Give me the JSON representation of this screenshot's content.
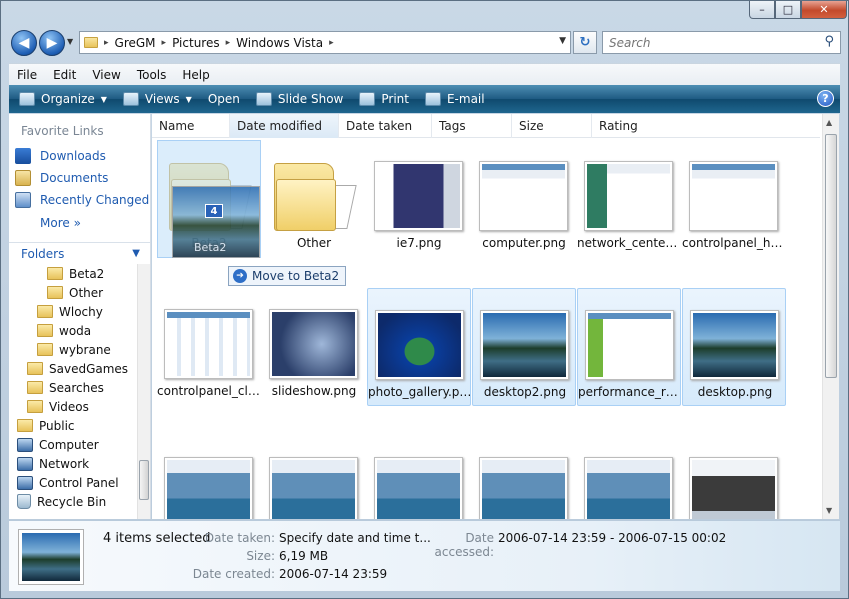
{
  "window": {
    "min": "–",
    "max": "□",
    "close": "✕"
  },
  "address": {
    "crumbs": [
      "GreGM",
      "Pictures",
      "Windows Vista"
    ],
    "separator": "▸"
  },
  "search": {
    "placeholder": "Search"
  },
  "menu": [
    "File",
    "Edit",
    "View",
    "Tools",
    "Help"
  ],
  "commands": {
    "organize": "Organize",
    "views": "Views",
    "open": "Open",
    "slideshow": "Slide Show",
    "print": "Print",
    "email": "E-mail",
    "help": "?"
  },
  "nav": {
    "favorites_title": "Favorite Links",
    "favorites": [
      "Downloads",
      "Documents",
      "Recently Changed"
    ],
    "more": "More",
    "more_glyph": "»",
    "folders_title": "Folders",
    "tree": [
      {
        "label": "Beta2",
        "indent": 3
      },
      {
        "label": "Other",
        "indent": 3
      },
      {
        "label": "Wlochy",
        "indent": 2
      },
      {
        "label": "woda",
        "indent": 2
      },
      {
        "label": "wybrane",
        "indent": 2
      },
      {
        "label": "SavedGames",
        "indent": 1
      },
      {
        "label": "Searches",
        "indent": 1
      },
      {
        "label": "Videos",
        "indent": 1
      },
      {
        "label": "Public",
        "indent": 0
      },
      {
        "label": "Computer",
        "indent": 0
      },
      {
        "label": "Network",
        "indent": 0
      },
      {
        "label": "Control Panel",
        "indent": 0
      },
      {
        "label": "Recycle Bin",
        "indent": 0
      }
    ]
  },
  "columns": [
    "Name",
    "Date modified",
    "Date taken",
    "Tags",
    "Size",
    "Rating"
  ],
  "files": [
    {
      "label": "Beta2",
      "kind": "folder",
      "selected": false
    },
    {
      "label": "Other",
      "kind": "folder",
      "selected": false
    },
    {
      "label": "ie7.png",
      "kind": "ie",
      "selected": false
    },
    {
      "label": "computer.png",
      "kind": "win",
      "selected": false
    },
    {
      "label": "network_center....",
      "kind": "green",
      "selected": false
    },
    {
      "label": "controlpanel_ho...",
      "kind": "win",
      "selected": false
    },
    {
      "label": "controlpanel_cla...",
      "kind": "cp",
      "selected": false
    },
    {
      "label": "slideshow.png",
      "kind": "slide",
      "selected": false
    },
    {
      "label": "photo_gallery.png",
      "kind": "turtle",
      "selected": true
    },
    {
      "label": "desktop2.png",
      "kind": "vista",
      "selected": true
    },
    {
      "label": "performance_rat...",
      "kind": "perf",
      "selected": true
    },
    {
      "label": "desktop.png",
      "kind": "vista",
      "selected": true
    },
    {
      "label": "",
      "kind": "vistawin",
      "selected": false
    },
    {
      "label": "",
      "kind": "vistawin",
      "selected": false
    },
    {
      "label": "",
      "kind": "vistawin",
      "selected": false
    },
    {
      "label": "",
      "kind": "vistawin",
      "selected": false
    },
    {
      "label": "",
      "kind": "vistawin",
      "selected": false
    },
    {
      "label": "",
      "kind": "dark",
      "selected": false
    }
  ],
  "drag": {
    "count": "4",
    "target_label": "Beta2",
    "tooltip": "Move to Beta2",
    "arrow": "➔"
  },
  "details": {
    "count": "4 items selected",
    "date_taken_label": "Date taken:",
    "date_taken": "Specify date and time t...",
    "date_accessed_label": "Date accessed:",
    "date_accessed": "2006-07-14 23:59 - 2006-07-15 00:02",
    "size_label": "Size:",
    "size": "6,19 MB",
    "date_created_label": "Date created:",
    "date_created": "2006-07-14 23:59"
  }
}
